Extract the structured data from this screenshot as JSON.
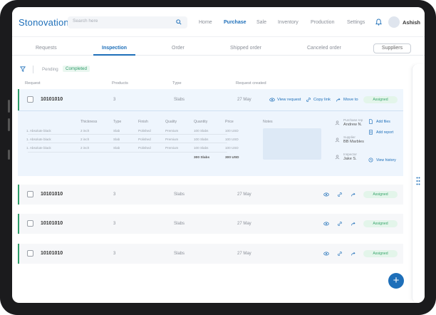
{
  "app": {
    "title": "Stonovation"
  },
  "search": {
    "placeholder": "Search here"
  },
  "nav": {
    "items": [
      "Home",
      "Purchase",
      "Sale",
      "Inventory",
      "Production",
      "Settings"
    ],
    "active": "Purchase"
  },
  "user": {
    "name": "Ashish"
  },
  "tabs": {
    "items": [
      "Requests",
      "Inspection",
      "Order",
      "Shipped order",
      "Canceled order"
    ],
    "active": "Inspection",
    "suppliers_label": "Suppliers"
  },
  "filters": {
    "pending": "Pending",
    "completed": "Completed"
  },
  "table": {
    "headers": [
      "Request",
      "Products",
      "Type",
      "Request created"
    ],
    "rows": [
      {
        "id": "10101010",
        "products": "3",
        "type": "Slabs",
        "created": "27 May",
        "status": "Assigned"
      },
      {
        "id": "10101010",
        "products": "3",
        "type": "Slabs",
        "created": "27 May",
        "status": "Assigned"
      },
      {
        "id": "10101010",
        "products": "3",
        "type": "Slabs",
        "created": "27 May",
        "status": "Assigned"
      },
      {
        "id": "10101010",
        "products": "3",
        "type": "Slabs",
        "created": "27 May",
        "status": "Assigned"
      }
    ],
    "row_actions": {
      "view": "View request",
      "copy": "Copy link",
      "move": "Move to"
    }
  },
  "detail": {
    "headers": [
      "Thickness",
      "Type",
      "Finish",
      "Quality",
      "Quantity",
      "Price"
    ],
    "items": [
      {
        "name": "1. Absolute black",
        "thickness": "2 inch",
        "type": "Slab",
        "finish": "Polished",
        "quality": "Premium",
        "quantity": "100 Slabs",
        "price": "100 USD"
      },
      {
        "name": "1. Absolute black",
        "thickness": "2 inch",
        "type": "Slab",
        "finish": "Polished",
        "quality": "Premium",
        "quantity": "100 Slabs",
        "price": "100 USD"
      },
      {
        "name": "1. Absolute black",
        "thickness": "2 inch",
        "type": "Slab",
        "finish": "Polished",
        "quality": "Premium",
        "quantity": "100 Slabs",
        "price": "100 USD"
      }
    ],
    "total_quantity": "300 Slabs",
    "total_price": "300 USD",
    "notes_label": "Notes",
    "people": [
      {
        "role": "Purchase rep",
        "name": "Andrew N."
      },
      {
        "role": "Supplier",
        "name": "BB Marbles"
      },
      {
        "role": "Inspector",
        "name": "Jake S."
      }
    ],
    "links": {
      "add_files": "Add files",
      "add_report": "Add report",
      "view_history": "View history"
    }
  },
  "colors": {
    "primary": "#1e6fb9",
    "success": "#2f9c6a",
    "assigned_bg": "#e3f5ea"
  }
}
